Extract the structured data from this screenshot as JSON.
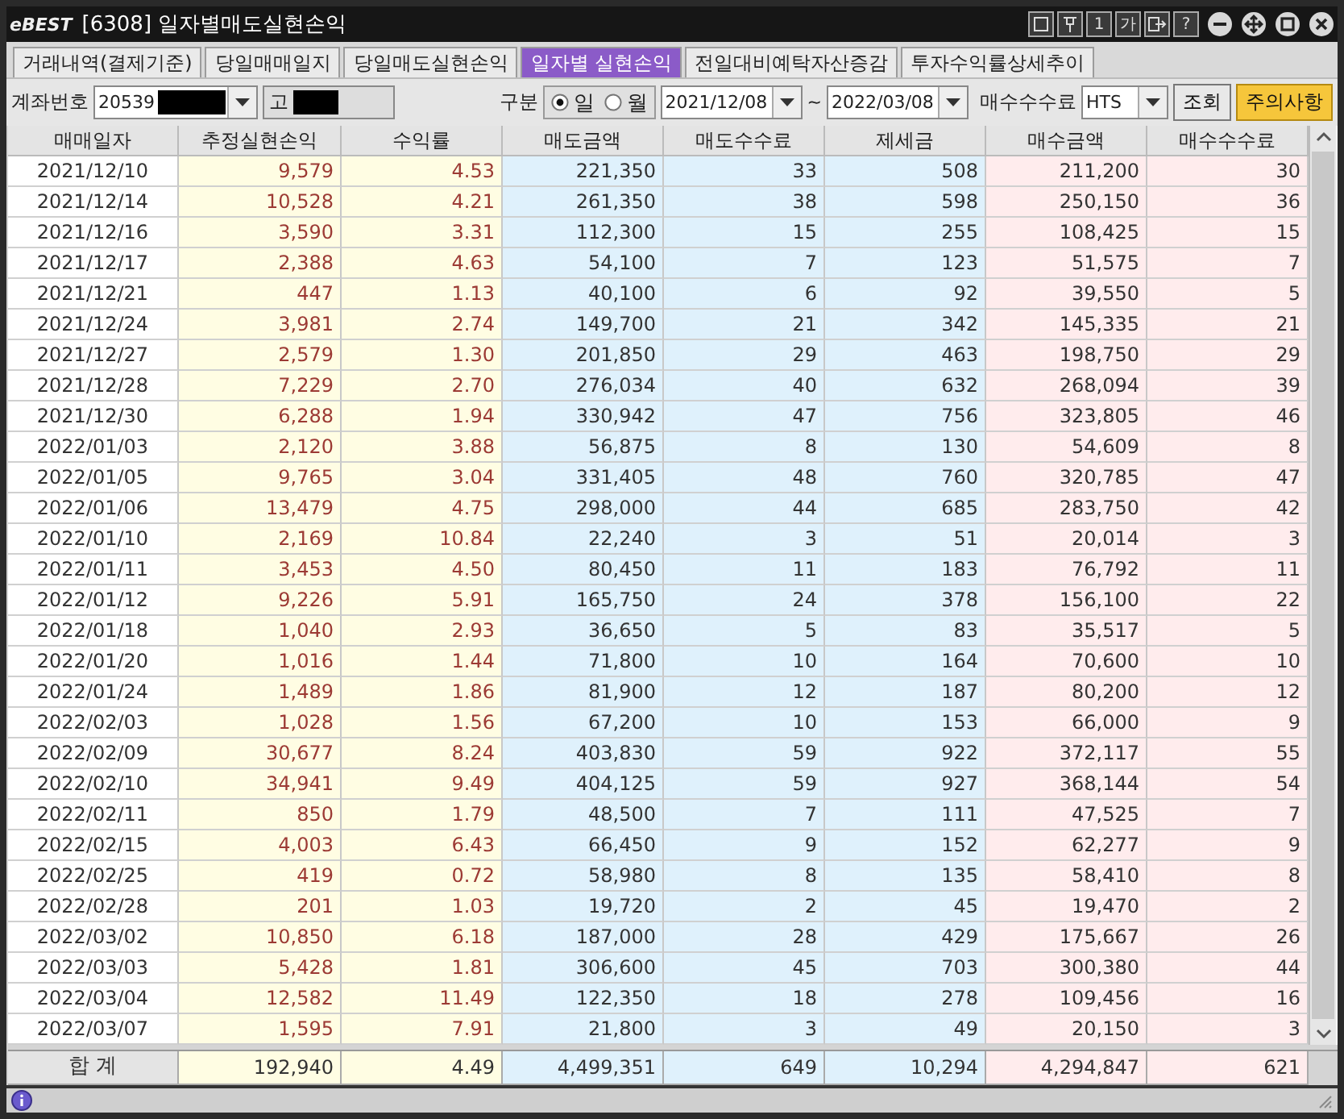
{
  "window": {
    "logo": "eBEST",
    "title": "[6308] 일자별매도실현손익",
    "title_buttons": [
      {
        "kind": "box"
      },
      {
        "kind": "pin"
      },
      {
        "kind": "text",
        "label": "1"
      },
      {
        "kind": "text",
        "label": "가"
      },
      {
        "kind": "export"
      },
      {
        "kind": "text",
        "label": "?"
      },
      {
        "kind": "minimize"
      },
      {
        "kind": "move"
      },
      {
        "kind": "maximize"
      },
      {
        "kind": "close"
      }
    ]
  },
  "tabs": [
    {
      "label": "거래내역(결제기준)",
      "selected": false
    },
    {
      "label": "당일매매일지",
      "selected": false
    },
    {
      "label": "당일매도실현손익",
      "selected": false
    },
    {
      "label": "일자별 실현손익",
      "selected": true
    },
    {
      "label": "전일대비예탁자산증감",
      "selected": false
    },
    {
      "label": "투자수익률상세추이",
      "selected": false
    }
  ],
  "filters": {
    "account_label": "계좌번호",
    "account_value": "20539",
    "account_name": "고",
    "type_label": "구분",
    "type_options": [
      {
        "label": "일",
        "selected": true
      },
      {
        "label": "월",
        "selected": false
      }
    ],
    "date_from": "2021/12/08",
    "date_separator": "~",
    "date_to": "2022/03/08",
    "fee_label": "매수수수료",
    "fee_value": "HTS",
    "buttons": [
      {
        "label": "조회",
        "kind": "plain"
      },
      {
        "label": "주의사항",
        "kind": "highlight"
      }
    ]
  },
  "table": {
    "columns": [
      {
        "label": "매매일자",
        "color": "#ffffff",
        "kind": "plain"
      },
      {
        "label": "추정실현손익",
        "color": "#fffde3",
        "kind": "profit"
      },
      {
        "label": "수익률",
        "color": "#fffde3",
        "kind": "profit"
      },
      {
        "label": "매도금액",
        "color": "#dff1fc",
        "kind": "plain"
      },
      {
        "label": "매도수수료",
        "color": "#dff1fc",
        "kind": "plain"
      },
      {
        "label": "제세금",
        "color": "#dff1fc",
        "kind": "plain"
      },
      {
        "label": "매수금액",
        "color": "#ffeced",
        "kind": "plain"
      },
      {
        "label": "매수수수료",
        "color": "#ffeced",
        "kind": "plain"
      }
    ],
    "rows": [
      [
        "2021/12/10",
        "9,579",
        "4.53",
        "221,350",
        "33",
        "508",
        "211,200",
        "30"
      ],
      [
        "2021/12/14",
        "10,528",
        "4.21",
        "261,350",
        "38",
        "598",
        "250,150",
        "36"
      ],
      [
        "2021/12/16",
        "3,590",
        "3.31",
        "112,300",
        "15",
        "255",
        "108,425",
        "15"
      ],
      [
        "2021/12/17",
        "2,388",
        "4.63",
        "54,100",
        "7",
        "123",
        "51,575",
        "7"
      ],
      [
        "2021/12/21",
        "447",
        "1.13",
        "40,100",
        "6",
        "92",
        "39,550",
        "5"
      ],
      [
        "2021/12/24",
        "3,981",
        "2.74",
        "149,700",
        "21",
        "342",
        "145,335",
        "21"
      ],
      [
        "2021/12/27",
        "2,579",
        "1.30",
        "201,850",
        "29",
        "463",
        "198,750",
        "29"
      ],
      [
        "2021/12/28",
        "7,229",
        "2.70",
        "276,034",
        "40",
        "632",
        "268,094",
        "39"
      ],
      [
        "2021/12/30",
        "6,288",
        "1.94",
        "330,942",
        "47",
        "756",
        "323,805",
        "46"
      ],
      [
        "2022/01/03",
        "2,120",
        "3.88",
        "56,875",
        "8",
        "130",
        "54,609",
        "8"
      ],
      [
        "2022/01/05",
        "9,765",
        "3.04",
        "331,405",
        "48",
        "760",
        "320,785",
        "47"
      ],
      [
        "2022/01/06",
        "13,479",
        "4.75",
        "298,000",
        "44",
        "685",
        "283,750",
        "42"
      ],
      [
        "2022/01/10",
        "2,169",
        "10.84",
        "22,240",
        "3",
        "51",
        "20,014",
        "3"
      ],
      [
        "2022/01/11",
        "3,453",
        "4.50",
        "80,450",
        "11",
        "183",
        "76,792",
        "11"
      ],
      [
        "2022/01/12",
        "9,226",
        "5.91",
        "165,750",
        "24",
        "378",
        "156,100",
        "22"
      ],
      [
        "2022/01/18",
        "1,040",
        "2.93",
        "36,650",
        "5",
        "83",
        "35,517",
        "5"
      ],
      [
        "2022/01/20",
        "1,016",
        "1.44",
        "71,800",
        "10",
        "164",
        "70,600",
        "10"
      ],
      [
        "2022/01/24",
        "1,489",
        "1.86",
        "81,900",
        "12",
        "187",
        "80,200",
        "12"
      ],
      [
        "2022/02/03",
        "1,028",
        "1.56",
        "67,200",
        "10",
        "153",
        "66,000",
        "9"
      ],
      [
        "2022/02/09",
        "30,677",
        "8.24",
        "403,830",
        "59",
        "922",
        "372,117",
        "55"
      ],
      [
        "2022/02/10",
        "34,941",
        "9.49",
        "404,125",
        "59",
        "927",
        "368,144",
        "54"
      ],
      [
        "2022/02/11",
        "850",
        "1.79",
        "48,500",
        "7",
        "111",
        "47,525",
        "7"
      ],
      [
        "2022/02/15",
        "4,003",
        "6.43",
        "66,450",
        "9",
        "152",
        "62,277",
        "9"
      ],
      [
        "2022/02/25",
        "419",
        "0.72",
        "58,980",
        "8",
        "135",
        "58,410",
        "8"
      ],
      [
        "2022/02/28",
        "201",
        "1.03",
        "19,720",
        "2",
        "45",
        "19,470",
        "2"
      ],
      [
        "2022/03/02",
        "10,850",
        "6.18",
        "187,000",
        "28",
        "429",
        "175,667",
        "26"
      ],
      [
        "2022/03/03",
        "5,428",
        "1.81",
        "306,600",
        "45",
        "703",
        "300,380",
        "44"
      ],
      [
        "2022/03/04",
        "12,582",
        "11.49",
        "122,350",
        "18",
        "278",
        "109,456",
        "16"
      ],
      [
        "2022/03/07",
        "1,595",
        "7.91",
        "21,800",
        "3",
        "49",
        "20,150",
        "3"
      ]
    ],
    "totals": [
      "합 계",
      "192,940",
      "4.49",
      "4,499,351",
      "649",
      "10,294",
      "4,294,847",
      "621"
    ]
  }
}
